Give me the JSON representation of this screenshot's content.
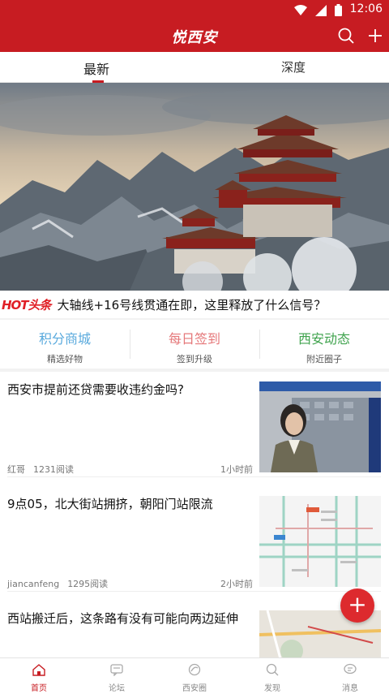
{
  "status_bar": {
    "time": "12:06"
  },
  "app_bar": {
    "title": "悦西安"
  },
  "tabs": [
    {
      "label": "最新"
    },
    {
      "label": "深度"
    }
  ],
  "hot": {
    "logo": "HOT头条",
    "headline": "大轴线+16号线贯通在即，这里释放了什么信号？"
  },
  "shortcuts": [
    {
      "title": "积分商城",
      "subtitle": "精选好物",
      "color": "#5aaadd"
    },
    {
      "title": "每日签到",
      "subtitle": "签到升级",
      "color": "#e5787a"
    },
    {
      "title": "西安动态",
      "subtitle": "附近圈子",
      "color": "#3fa34d"
    }
  ],
  "articles": [
    {
      "title": "西安市提前还贷需要收违约金吗?",
      "author": "红哥",
      "reads": "1231阅读",
      "time": "1小时前"
    },
    {
      "title": "9点05，北大街站拥挤，朝阳门站限流",
      "author": "jiancanfeng",
      "reads": "1295阅读",
      "time": "2小时前"
    },
    {
      "title": "西站搬迁后，这条路有没有可能向两边延伸",
      "author": "",
      "reads": "",
      "time": ""
    }
  ],
  "fab": {
    "symbol": "+"
  },
  "bottom_nav": [
    {
      "label": "首页",
      "icon": "home-icon"
    },
    {
      "label": "论坛",
      "icon": "forum-icon"
    },
    {
      "label": "西安圈",
      "icon": "circle-icon"
    },
    {
      "label": "发现",
      "icon": "discover-icon"
    },
    {
      "label": "消息",
      "icon": "message-icon"
    }
  ],
  "colors": {
    "brand": "#c71c22",
    "fab": "#dd2a2e"
  }
}
